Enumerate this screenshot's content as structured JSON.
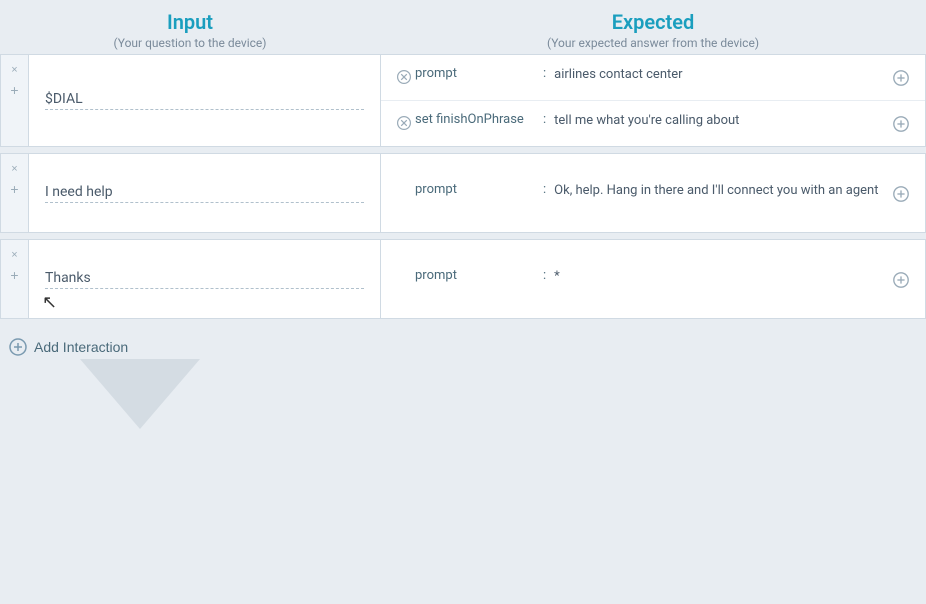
{
  "header": {
    "input_title": "Input",
    "input_subtitle": "(Your question to the device)",
    "expected_title": "Expected",
    "expected_subtitle": "(Your expected answer from the device)"
  },
  "interactions": [
    {
      "id": "dial-block",
      "input_value": "$DIAL",
      "rows": [
        {
          "id": "row-1",
          "has_remove": true,
          "prompt_label": "prompt",
          "answer": "airlines contact center"
        },
        {
          "id": "row-2",
          "has_remove": true,
          "prompt_label": "set finishOnPhrase",
          "answer": "tell me what you're calling about"
        }
      ]
    },
    {
      "id": "help-block",
      "input_value": "I need help",
      "rows": [
        {
          "id": "row-3",
          "has_remove": false,
          "prompt_label": "prompt",
          "answer": "Ok, help. Hang in there and I'll connect you with an agent"
        }
      ]
    },
    {
      "id": "thanks-block",
      "input_value": "Thanks",
      "rows": [
        {
          "id": "row-4",
          "has_remove": false,
          "prompt_label": "prompt",
          "answer": "*"
        }
      ]
    }
  ],
  "add_interaction_label": "Add Interaction",
  "controls": {
    "remove_label": "×",
    "add_label": "+"
  }
}
